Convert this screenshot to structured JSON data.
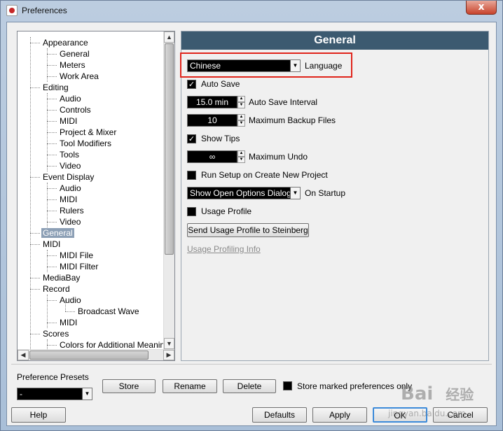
{
  "window": {
    "title": "Preferences",
    "close_glyph": "x"
  },
  "tree": {
    "items": [
      {
        "label": "Appearance",
        "level": 1
      },
      {
        "label": "General",
        "level": 2
      },
      {
        "label": "Meters",
        "level": 2
      },
      {
        "label": "Work Area",
        "level": 2
      },
      {
        "label": "Editing",
        "level": 1
      },
      {
        "label": "Audio",
        "level": 2
      },
      {
        "label": "Controls",
        "level": 2
      },
      {
        "label": "MIDI",
        "level": 2
      },
      {
        "label": "Project & Mixer",
        "level": 2
      },
      {
        "label": "Tool Modifiers",
        "level": 2
      },
      {
        "label": "Tools",
        "level": 2
      },
      {
        "label": "Video",
        "level": 2
      },
      {
        "label": "Event Display",
        "level": 1
      },
      {
        "label": "Audio",
        "level": 2
      },
      {
        "label": "MIDI",
        "level": 2
      },
      {
        "label": "Rulers",
        "level": 2
      },
      {
        "label": "Video",
        "level": 2
      },
      {
        "label": "General",
        "level": 1,
        "selected": true
      },
      {
        "label": "MIDI",
        "level": 1
      },
      {
        "label": "MIDI File",
        "level": 2
      },
      {
        "label": "MIDI Filter",
        "level": 2
      },
      {
        "label": "MediaBay",
        "level": 1
      },
      {
        "label": "Record",
        "level": 1
      },
      {
        "label": "Audio",
        "level": 2
      },
      {
        "label": "Broadcast Wave",
        "level": 3
      },
      {
        "label": "MIDI",
        "level": 2
      },
      {
        "label": "Scores",
        "level": 1
      },
      {
        "label": "Colors for Additional Meanings",
        "level": 2
      }
    ]
  },
  "general": {
    "header": "General",
    "language_value": "Chinese",
    "language_label": "Language",
    "auto_save_label": "Auto Save",
    "auto_save_checked": true,
    "auto_save_interval_value": "15.0 min",
    "auto_save_interval_label": "Auto Save Interval",
    "max_backup_value": "10",
    "max_backup_label": "Maximum Backup Files",
    "show_tips_label": "Show Tips",
    "show_tips_checked": true,
    "max_undo_value": "∞",
    "max_undo_label": "Maximum Undo",
    "run_setup_label": "Run Setup on Create New Project",
    "run_setup_checked": false,
    "on_startup_value": "Show Open Options Dialog",
    "on_startup_label": "On Startup",
    "usage_profile_label": "Usage Profile",
    "usage_profile_checked": false,
    "send_usage_button": "Send Usage Profile to Steinberg",
    "usage_profiling_link": "Usage Profiling Info"
  },
  "presets": {
    "label": "Preference Presets",
    "select_value": "-",
    "store_button": "Store",
    "rename_button": "Rename",
    "delete_button": "Delete",
    "store_marked_label": "Store marked preferences only",
    "store_marked_checked": false
  },
  "footer": {
    "help_button": "Help",
    "defaults_button": "Defaults",
    "apply_button": "Apply",
    "ok_button": "OK",
    "cancel_button": "Cancel"
  },
  "watermark": {
    "text1": "Bai",
    "text2": "经验",
    "text3": "jingyan.baidu.com"
  },
  "colors": {
    "header_bg": "#3c5a70",
    "highlight": "#e0241b",
    "selected_bg": "#8c9fb5"
  }
}
